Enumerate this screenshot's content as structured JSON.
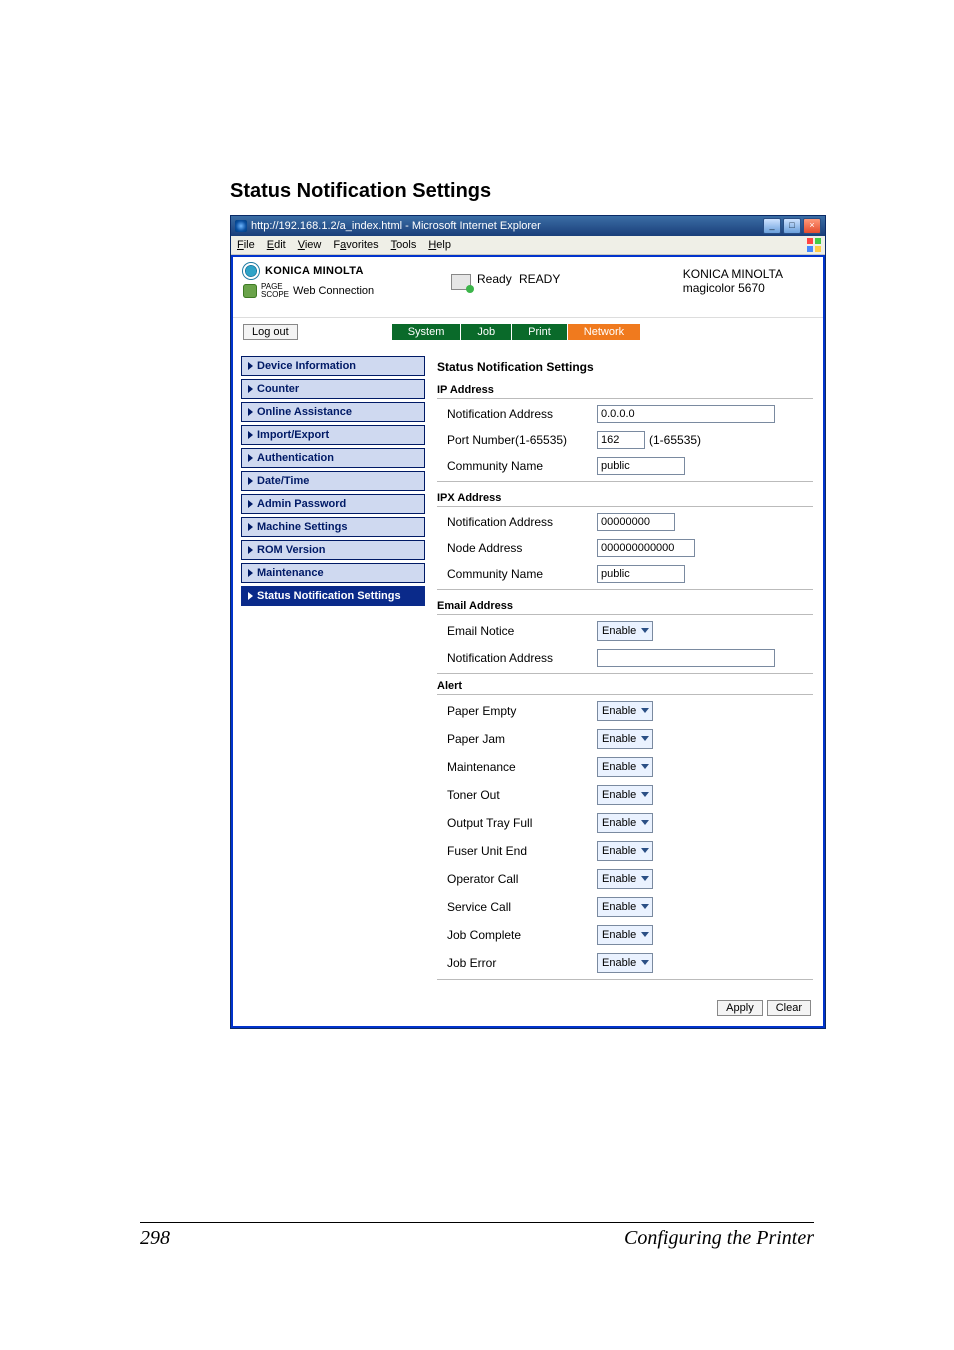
{
  "page": {
    "section_title": "Status Notification Settings",
    "number": "298",
    "footer_label": "Configuring the Printer"
  },
  "window": {
    "title": "http://192.168.1.2/a_index.html - Microsoft Internet Explorer",
    "menus": [
      "File",
      "Edit",
      "View",
      "Favorites",
      "Tools",
      "Help"
    ]
  },
  "header": {
    "brand": "KONICA MINOLTA",
    "pagescope_small": "PAGE\nSCOPE",
    "pagescope": "Web Connection",
    "status_label": "Ready",
    "status_big": "READY",
    "device_line1": "KONICA MINOLTA",
    "device_line2": "magicolor 5670"
  },
  "toolbar": {
    "logout": "Log out",
    "tabs": [
      "System",
      "Job",
      "Print",
      "Network"
    ],
    "active_index": 3
  },
  "nav": {
    "items": [
      "Device Information",
      "Counter",
      "Online Assistance",
      "Import/Export",
      "Authentication",
      "Date/Time",
      "Admin Password",
      "Machine Settings",
      "ROM Version",
      "Maintenance",
      "Status Notification Settings"
    ],
    "selected_index": 10
  },
  "panel": {
    "title": "Status Notification Settings",
    "groups": {
      "ip": {
        "label": "IP Address",
        "notif_addr": {
          "lbl": "Notification Address",
          "val": "0.0.0.0"
        },
        "port": {
          "lbl": "Port Number(1-65535)",
          "val": "162",
          "range": "(1-65535)"
        },
        "community": {
          "lbl": "Community Name",
          "val": "public"
        }
      },
      "ipx": {
        "label": "IPX Address",
        "notif_addr": {
          "lbl": "Notification Address",
          "val": "00000000"
        },
        "node": {
          "lbl": "Node Address",
          "val": "000000000000"
        },
        "community": {
          "lbl": "Community Name",
          "val": "public"
        }
      },
      "email": {
        "label": "Email Address",
        "notice": {
          "lbl": "Email Notice",
          "val": "Enable"
        },
        "addr": {
          "lbl": "Notification Address",
          "val": ""
        }
      },
      "alert": {
        "label": "Alert",
        "items": [
          {
            "lbl": "Paper Empty",
            "val": "Enable"
          },
          {
            "lbl": "Paper Jam",
            "val": "Enable"
          },
          {
            "lbl": "Maintenance",
            "val": "Enable"
          },
          {
            "lbl": "Toner Out",
            "val": "Enable"
          },
          {
            "lbl": "Output Tray Full",
            "val": "Enable"
          },
          {
            "lbl": "Fuser Unit End",
            "val": "Enable"
          },
          {
            "lbl": "Operator Call",
            "val": "Enable"
          },
          {
            "lbl": "Service Call",
            "val": "Enable"
          },
          {
            "lbl": "Job Complete",
            "val": "Enable"
          },
          {
            "lbl": "Job Error",
            "val": "Enable"
          }
        ]
      }
    },
    "buttons": {
      "apply": "Apply",
      "clear": "Clear"
    }
  }
}
